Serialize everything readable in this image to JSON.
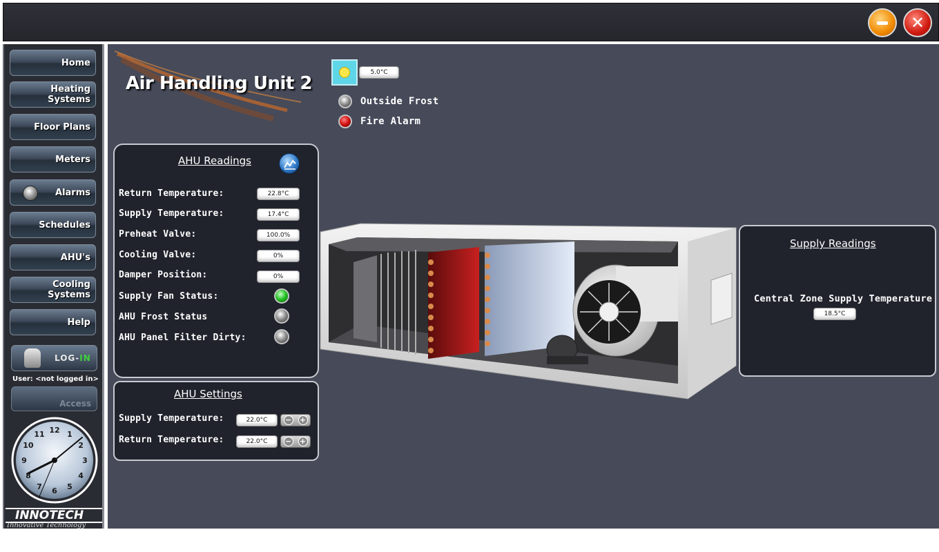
{
  "window": {
    "minimize_icon": "minimize-icon",
    "close_icon": "close-icon",
    "close_glyph": "✕"
  },
  "sidebar": {
    "nav": [
      {
        "label": "Home"
      },
      {
        "label_line1": "Heating",
        "label_line2": "Systems"
      },
      {
        "label": "Floor Plans"
      },
      {
        "label": "Meters"
      },
      {
        "label": "Alarms"
      },
      {
        "label": "Schedules"
      },
      {
        "label": "AHU's"
      },
      {
        "label_line1": "Cooling",
        "label_line2": "Systems"
      },
      {
        "label": "Help"
      }
    ],
    "login": {
      "text_prefix": "LOG-",
      "text_suffix": "IN"
    },
    "user_label": "User: <not logged in>",
    "access_label": "Access",
    "clock_numbers": [
      "12",
      "1",
      "2",
      "3",
      "4",
      "5",
      "6",
      "7",
      "8",
      "9",
      "10",
      "11"
    ],
    "brand": "INNOTECH",
    "tagline": "Innovative Technology"
  },
  "main": {
    "title": "Air Handling Unit 2",
    "outside_temp": "5.0°C",
    "status": [
      {
        "label": "Outside Frost",
        "state": "off"
      },
      {
        "label": "Fire Alarm",
        "state": "alarm"
      }
    ]
  },
  "ahu_readings": {
    "title": "AHU Readings",
    "rows": [
      {
        "label": "Return Temperature:",
        "value": "22.8°C"
      },
      {
        "label": "Supply Temperature:",
        "value": "17.4°C"
      },
      {
        "label": "Preheat Valve:",
        "value": "100.0%"
      },
      {
        "label": "Cooling Valve:",
        "value": "0%"
      },
      {
        "label": "Damper Position:",
        "value": "0%"
      }
    ],
    "indicators": [
      {
        "label": "Supply Fan Status:",
        "state": "on"
      },
      {
        "label": "AHU Frost Status",
        "state": "off"
      },
      {
        "label": "AHU Panel Filter Dirty:",
        "state": "off"
      }
    ]
  },
  "ahu_settings": {
    "title": "AHU Settings",
    "rows": [
      {
        "label": "Supply Temperature:",
        "value": "22.0°C"
      },
      {
        "label": "Return Temperature:",
        "value": "22.0°C"
      }
    ],
    "minus": "−",
    "plus": "+"
  },
  "supply_readings": {
    "title": "Supply Readings",
    "label": "Central Zone Supply Temperature",
    "value": "18.5°C"
  },
  "colors": {
    "main_bg": "#464a59",
    "panel_bg": "#20232c",
    "led_green": "#22c022",
    "led_red": "#d01010"
  }
}
